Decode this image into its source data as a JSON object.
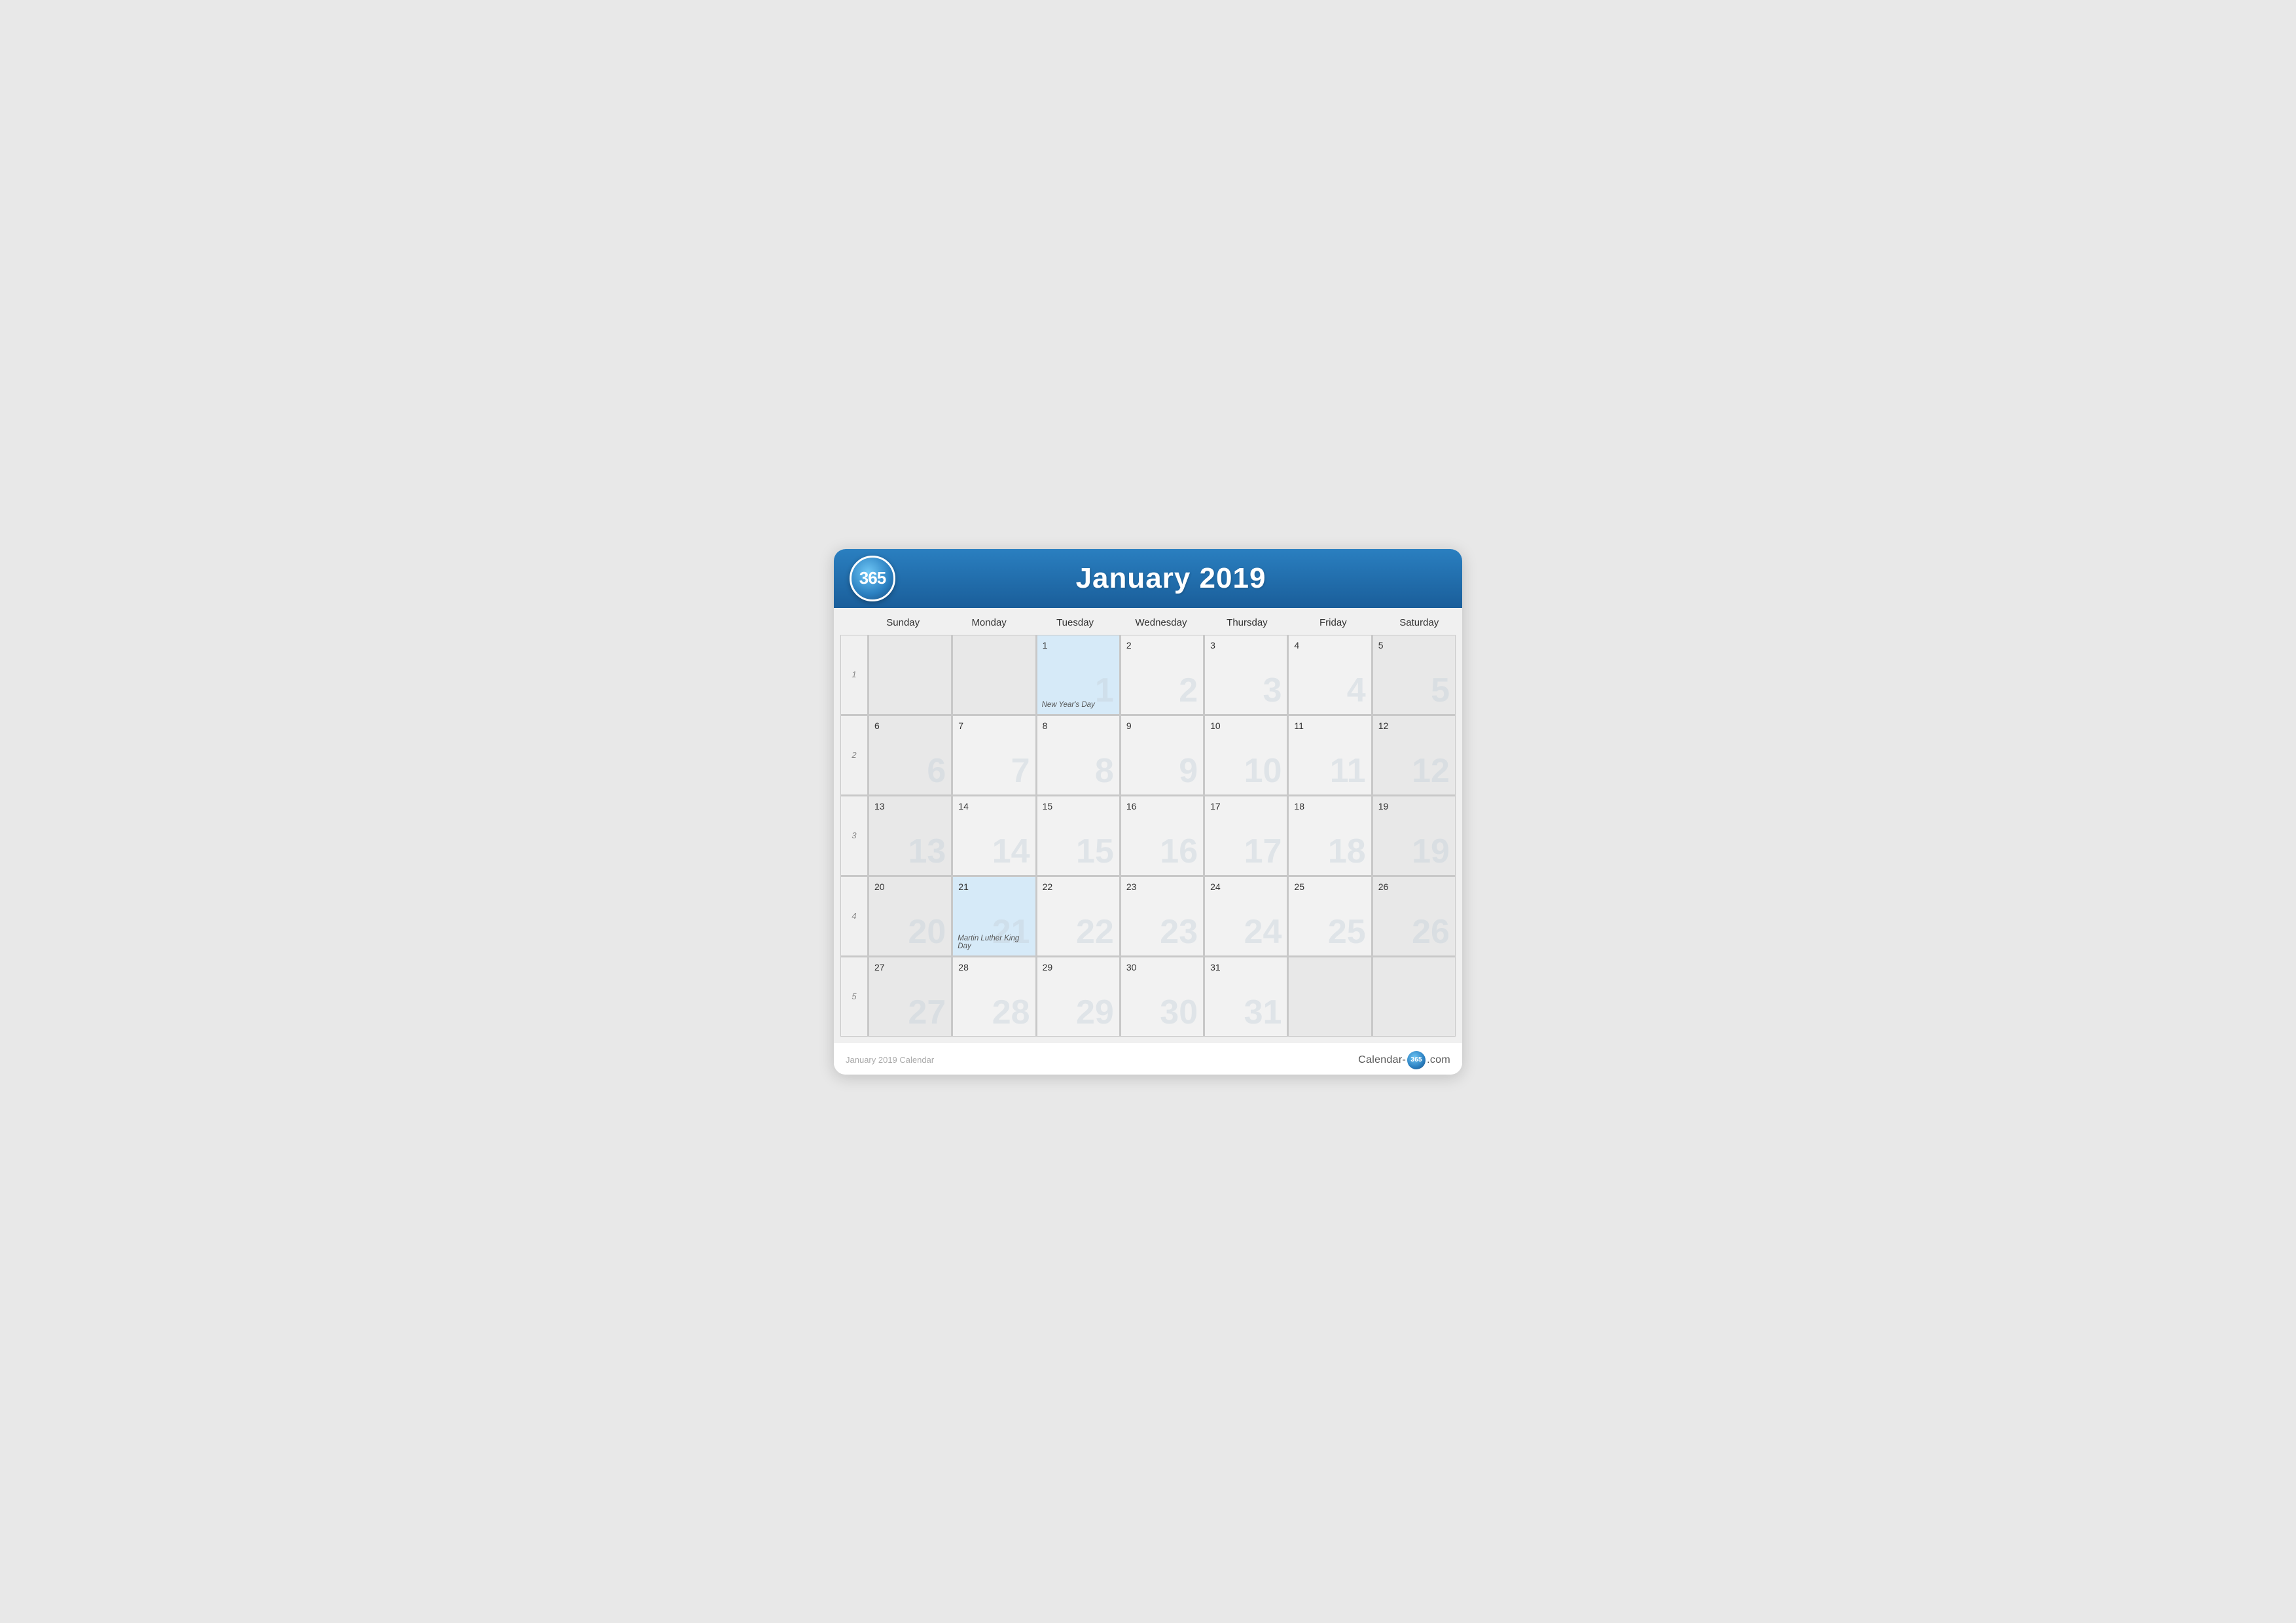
{
  "header": {
    "logo_text": "365",
    "title": "January 2019"
  },
  "day_headers": [
    "Sunday",
    "Monday",
    "Tuesday",
    "Wednesday",
    "Thursday",
    "Friday",
    "Saturday"
  ],
  "weeks": [
    {
      "week_num": "1",
      "days": [
        {
          "num": "",
          "type": "empty"
        },
        {
          "num": "",
          "type": "empty"
        },
        {
          "num": "1",
          "type": "holiday",
          "holiday": "New Year's Day"
        },
        {
          "num": "2",
          "type": "normal"
        },
        {
          "num": "3",
          "type": "normal"
        },
        {
          "num": "4",
          "type": "normal"
        },
        {
          "num": "5",
          "type": "saturday"
        }
      ]
    },
    {
      "week_num": "2",
      "days": [
        {
          "num": "6",
          "type": "sunday"
        },
        {
          "num": "7",
          "type": "normal"
        },
        {
          "num": "8",
          "type": "normal"
        },
        {
          "num": "9",
          "type": "normal"
        },
        {
          "num": "10",
          "type": "normal"
        },
        {
          "num": "11",
          "type": "normal"
        },
        {
          "num": "12",
          "type": "saturday"
        }
      ]
    },
    {
      "week_num": "3",
      "days": [
        {
          "num": "13",
          "type": "sunday"
        },
        {
          "num": "14",
          "type": "normal"
        },
        {
          "num": "15",
          "type": "normal"
        },
        {
          "num": "16",
          "type": "normal"
        },
        {
          "num": "17",
          "type": "normal"
        },
        {
          "num": "18",
          "type": "normal"
        },
        {
          "num": "19",
          "type": "saturday"
        }
      ]
    },
    {
      "week_num": "4",
      "days": [
        {
          "num": "20",
          "type": "sunday"
        },
        {
          "num": "21",
          "type": "holiday",
          "holiday": "Martin Luther King Day"
        },
        {
          "num": "22",
          "type": "normal"
        },
        {
          "num": "23",
          "type": "normal"
        },
        {
          "num": "24",
          "type": "normal"
        },
        {
          "num": "25",
          "type": "normal"
        },
        {
          "num": "26",
          "type": "saturday"
        }
      ]
    },
    {
      "week_num": "5",
      "days": [
        {
          "num": "27",
          "type": "sunday"
        },
        {
          "num": "28",
          "type": "normal"
        },
        {
          "num": "29",
          "type": "normal"
        },
        {
          "num": "30",
          "type": "normal"
        },
        {
          "num": "31",
          "type": "normal"
        },
        {
          "num": "",
          "type": "empty"
        },
        {
          "num": "",
          "type": "empty"
        }
      ]
    }
  ],
  "footer": {
    "caption": "January 2019 Calendar",
    "brand_text_before": "Calendar-",
    "brand_logo": "365",
    "brand_text_after": ".com"
  }
}
